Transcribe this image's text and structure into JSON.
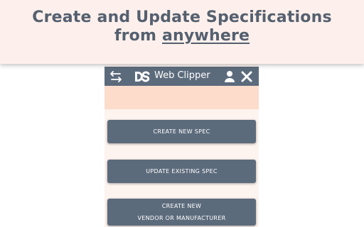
{
  "banner": {
    "line1": "Create and Update Specifications",
    "line2_prefix": "from ",
    "line2_emphasis": "anywhere"
  },
  "header": {
    "title": "Web Clipper",
    "icons": {
      "swap": "swap-arrows-icon",
      "logo": "ds-logo-icon",
      "user": "user-icon",
      "close": "close-icon"
    }
  },
  "buttons": {
    "create_spec": "CREATE NEW SPEC",
    "update_spec": "UPDATE EXISTING SPEC",
    "create_vendor_line1": "CREATE NEW",
    "create_vendor_line2": "VENDOR OR MANUFACTURER"
  },
  "colors": {
    "header_bg": "#5c6b7c",
    "banner_bg": "#fdf0ec",
    "banner_text": "#55606f",
    "band_bg": "#fddccc",
    "panel_bg": "#fdf3ef"
  }
}
